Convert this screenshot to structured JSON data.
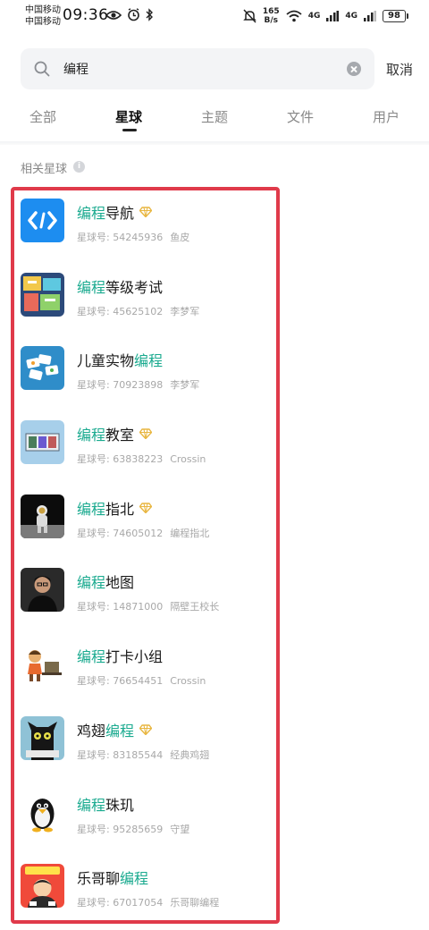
{
  "status_bar": {
    "carrier1": "中国移动",
    "carrier2": "中国移动",
    "time": "09:36",
    "speed_value": "165",
    "speed_unit": "B/s",
    "sig1": "4G",
    "sig2": "4G",
    "battery": "98"
  },
  "search": {
    "value": "编程",
    "placeholder": "",
    "cancel_label": "取消"
  },
  "tabs": [
    {
      "label": "全部"
    },
    {
      "label": "星球"
    },
    {
      "label": "主题"
    },
    {
      "label": "文件"
    },
    {
      "label": "用户"
    }
  ],
  "section": {
    "title": "相关星球",
    "info_glyph": "i"
  },
  "id_prefix": "星球号: ",
  "colors": {
    "highlight_text": "#1aaa8f",
    "frame": "#e03a4a",
    "gem": "#e8b640"
  },
  "planets": [
    {
      "pre": "",
      "hl": "编程",
      "post": "导航",
      "gem": true,
      "id": "54245936",
      "owner": "鱼皮",
      "avatar": "blue-code-logo"
    },
    {
      "pre": "",
      "hl": "编程",
      "post": "等级考试",
      "gem": false,
      "id": "45625102",
      "owner": "李梦军",
      "avatar": "colorful-poster"
    },
    {
      "pre": "儿童实物",
      "hl": "编程",
      "post": "",
      "gem": false,
      "id": "70923898",
      "owner": "李梦军",
      "avatar": "blue-cards"
    },
    {
      "pre": "",
      "hl": "编程",
      "post": "教室",
      "gem": true,
      "id": "63838223",
      "owner": "Crossin",
      "avatar": "classroom-screen"
    },
    {
      "pre": "",
      "hl": "编程",
      "post": "指北",
      "gem": true,
      "id": "74605012",
      "owner": "编程指北",
      "avatar": "astronaut"
    },
    {
      "pre": "",
      "hl": "编程",
      "post": "地图",
      "gem": false,
      "id": "14871000",
      "owner": "隔壁王校长",
      "avatar": "man-portrait"
    },
    {
      "pre": "",
      "hl": "编程",
      "post": "打卡小组",
      "gem": false,
      "id": "76654451",
      "owner": "Crossin",
      "avatar": "cartoon-coder"
    },
    {
      "pre": "鸡翅",
      "hl": "编程",
      "post": "",
      "gem": true,
      "id": "83185544",
      "owner": "经典鸡翅",
      "avatar": "black-cat"
    },
    {
      "pre": "",
      "hl": "编程",
      "post": "珠玑",
      "gem": false,
      "id": "95285659",
      "owner": "守望",
      "avatar": "penguin"
    },
    {
      "pre": "乐哥聊",
      "hl": "编程",
      "post": "",
      "gem": false,
      "id": "67017054",
      "owner": "乐哥聊编程",
      "avatar": "red-cartoon"
    }
  ]
}
